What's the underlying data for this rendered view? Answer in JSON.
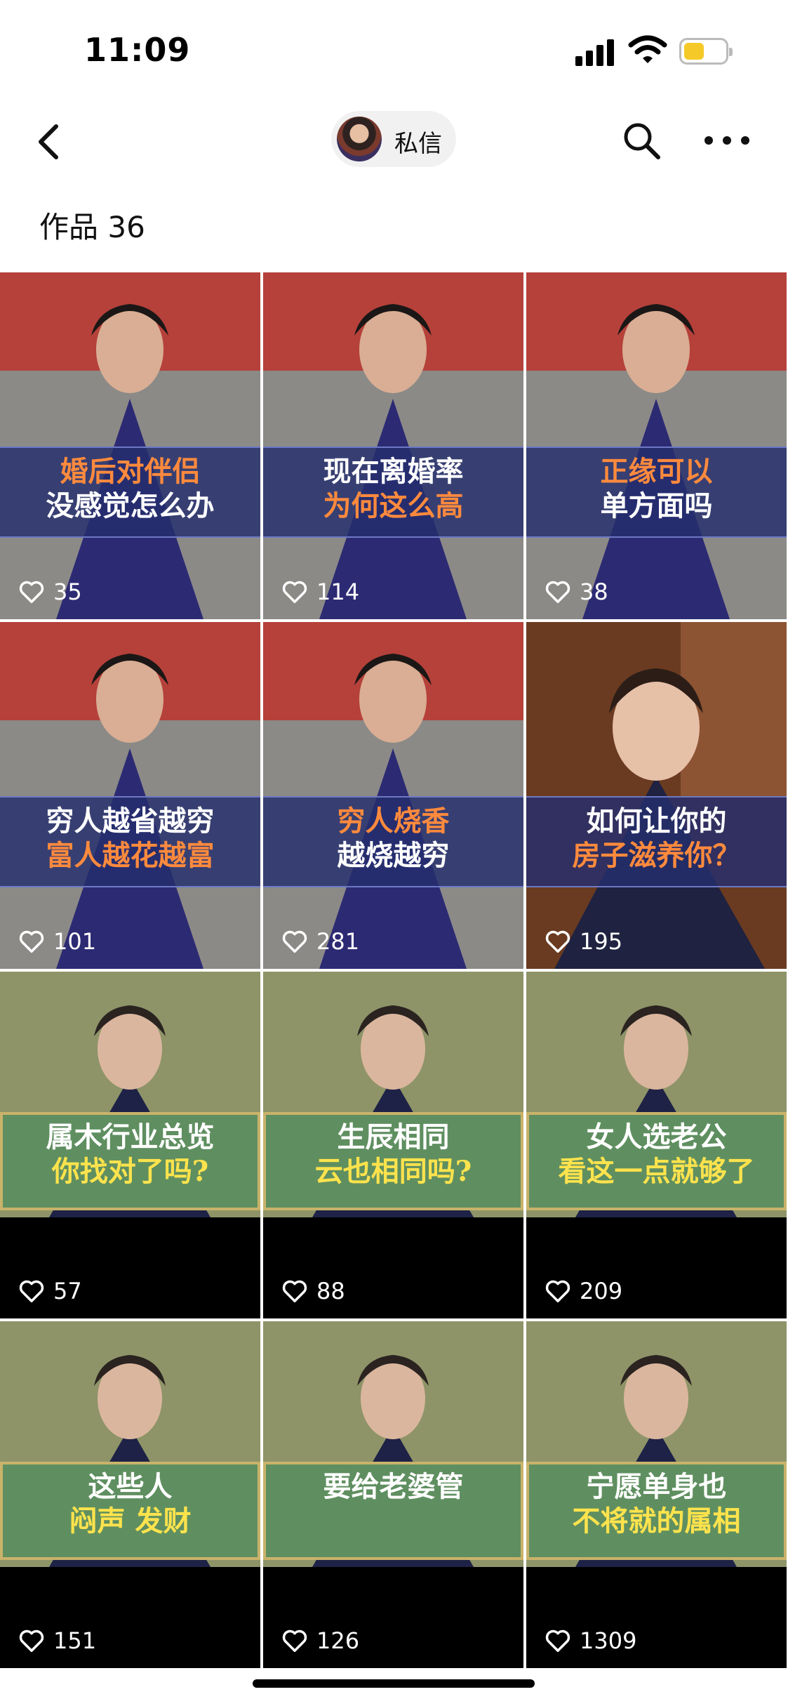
{
  "status": {
    "time": "11:09",
    "battery_color": "#f5c928"
  },
  "nav": {
    "back_icon": "chevron-left-icon",
    "message_label": "私信",
    "search_icon": "search-icon",
    "more_icon": "more-icon"
  },
  "works_label": "作品 36",
  "videos": [
    {
      "line1": "婚后对伴侣",
      "line2": "没感觉怎么办",
      "likes": "35",
      "style": "a"
    },
    {
      "line1": "现在离婚率",
      "line2": "为何这么高",
      "likes": "114",
      "style": "a"
    },
    {
      "line1": "正缘可以",
      "line2": "单方面吗",
      "likes": "38",
      "style": "a"
    },
    {
      "line1": "穷人越省越穷",
      "line2": "富人越花越富",
      "likes": "101",
      "style": "a"
    },
    {
      "line1": "穷人烧香",
      "line2": "越烧越穷",
      "likes": "281",
      "style": "a"
    },
    {
      "line1": "如何让你的",
      "line2": "房子滋养你？",
      "likes": "195",
      "style": "c"
    },
    {
      "line1": "属木行业总览",
      "line2": "你找对了吗?",
      "likes": "57",
      "style": "b"
    },
    {
      "line1": "生辰相同",
      "line2": "云也相同吗?",
      "likes": "88",
      "style": "b"
    },
    {
      "line1": "女人选老公",
      "line2": "看这一点就够了",
      "likes": "209",
      "style": "b"
    },
    {
      "line1": "这些人",
      "line2": "闷声 发财",
      "likes": "151",
      "style": "b"
    },
    {
      "line1": "要给老婆管",
      "line2": "",
      "likes": "126",
      "style": "b"
    },
    {
      "line1": "宁愿单身也",
      "line2": "不将就的属相",
      "likes": "1309",
      "style": "b"
    }
  ]
}
